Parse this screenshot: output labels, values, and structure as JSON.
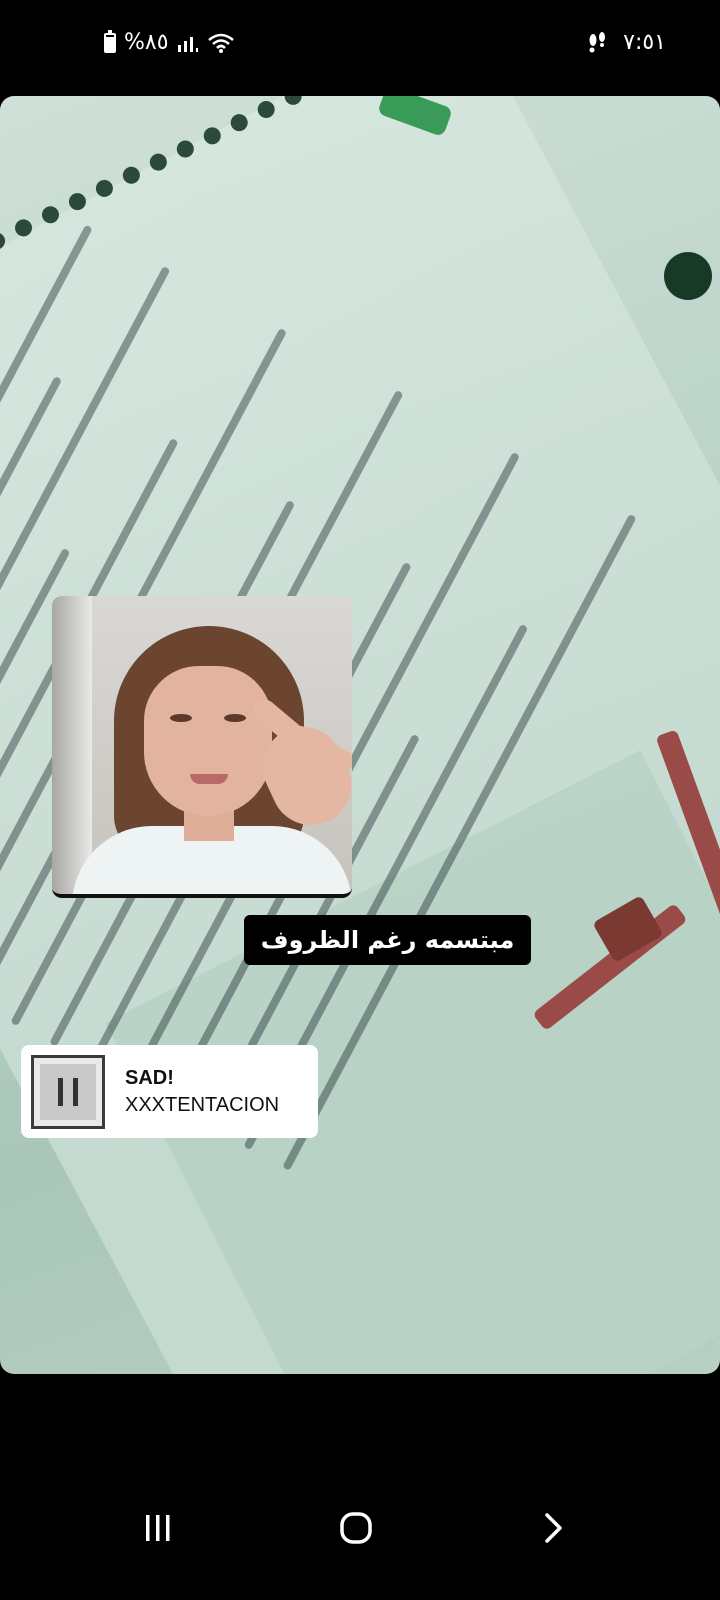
{
  "status_bar": {
    "battery_text": "%٨٥",
    "time": "٧:٥١"
  },
  "story": {
    "caption": "مبتسمه رغم الظروف",
    "music": {
      "title": "SAD!",
      "artist": "XXXTENTACION"
    }
  },
  "icons": {
    "battery": "battery-icon",
    "signal": "signal-icon",
    "wifi": "wifi-icon",
    "footsteps": "footsteps-icon",
    "recents": "recent-apps-icon",
    "home": "home-icon",
    "back": "back-icon"
  },
  "colors": {
    "background": "#000000",
    "caption_bg": "#000000",
    "caption_text": "#ffffff",
    "music_card_bg": "#ffffff"
  }
}
